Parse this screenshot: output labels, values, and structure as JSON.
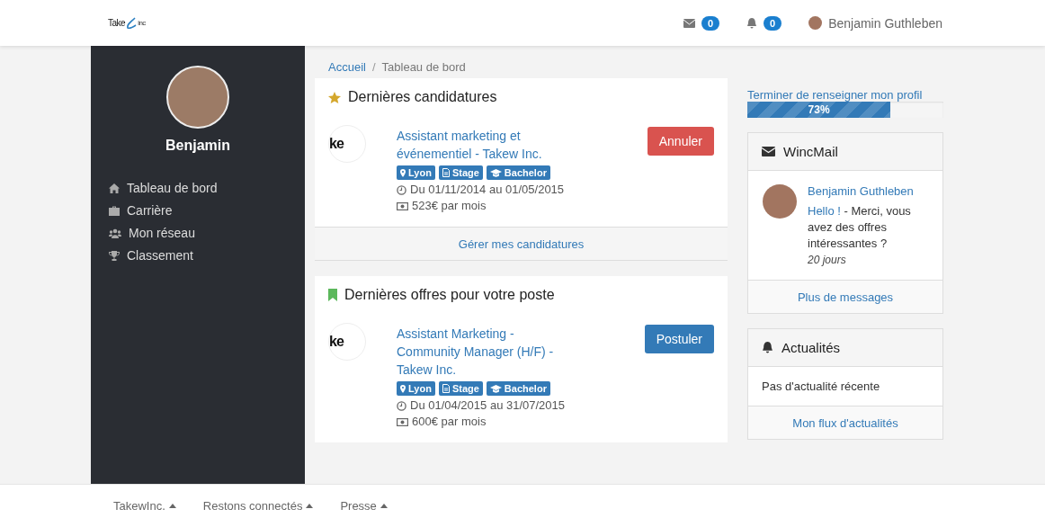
{
  "header": {
    "logo": {
      "left": "Take",
      "right": "inc"
    },
    "mail_count": "0",
    "notif_count": "0",
    "user_name": "Benjamin Guthleben"
  },
  "sidebar": {
    "user_name": "Benjamin",
    "items": [
      {
        "label": "Tableau de bord",
        "kind": "home"
      },
      {
        "label": "Carrière",
        "kind": "briefcase"
      },
      {
        "label": "Mon réseau",
        "kind": "users"
      },
      {
        "label": "Classement",
        "kind": "trophy"
      }
    ]
  },
  "breadcrumb": {
    "separator": "/",
    "items": [
      {
        "label": "Accueil",
        "link": true
      },
      {
        "label": "Tableau de bord",
        "link": false
      }
    ]
  },
  "sections": [
    {
      "title": "Dernières candidatures",
      "kind": "star",
      "items": [
        {
          "logo_text": "ke",
          "title": "Assistant marketing et événementiel - Takew Inc.",
          "tags": [
            {
              "label": "Lyon",
              "kind": "pin"
            },
            {
              "label": "Stage",
              "kind": "file"
            },
            {
              "label": "Bachelor",
              "kind": "cap"
            }
          ],
          "dates": "Du 01/11/2014 au 01/05/2015",
          "salary": "523€ par mois",
          "action": {
            "label": "Annuler",
            "kind": "danger"
          }
        }
      ],
      "footer_link": "Gérer mes candidatures"
    },
    {
      "title": "Dernières offres pour votre poste",
      "kind": "bookmark",
      "items": [
        {
          "logo_text": "ke",
          "title": "Assistant Marketing - Community Manager (H/F) - Takew Inc.",
          "tags": [
            {
              "label": "Lyon",
              "kind": "pin"
            },
            {
              "label": "Stage",
              "kind": "file"
            },
            {
              "label": "Bachelor",
              "kind": "cap"
            }
          ],
          "dates": "Du 01/04/2015 au 31/07/2015",
          "salary": "600€ par mois",
          "action": {
            "label": "Postuler",
            "kind": "primary"
          }
        }
      ]
    }
  ],
  "profile": {
    "label": "Terminer de renseigner mon profil",
    "level": 0.73,
    "reading": "73%"
  },
  "wincmail": {
    "title": "WincMail",
    "messages": [
      {
        "sender": "Benjamin Guthleben",
        "link_text": "Hello !",
        "text": " - Merci, vous avez des offres intéressantes ?",
        "time": "20 jours"
      }
    ],
    "footer_link": "Plus de messages"
  },
  "news": {
    "title": "Actualités",
    "empty_text": "Pas d'actualité récente",
    "footer_link": "Mon flux d'actualités"
  },
  "footer": [
    {
      "label": "TakewInc."
    },
    {
      "label": "Restons connectés"
    },
    {
      "label": "Presse"
    }
  ]
}
